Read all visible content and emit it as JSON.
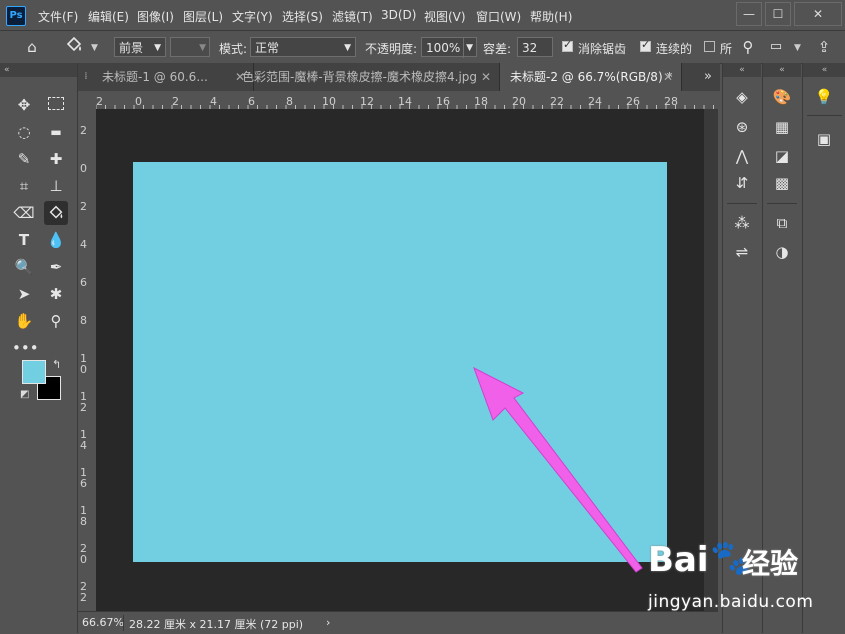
{
  "app": {
    "logo_text": "Ps"
  },
  "menu": [
    "文件(F)",
    "编辑(E)",
    "图像(I)",
    "图层(L)",
    "文字(Y)",
    "选择(S)",
    "滤镜(T)",
    "3D(D)",
    "视图(V)",
    "窗口(W)",
    "帮助(H)"
  ],
  "window_controls": {
    "minimize": "—",
    "maximize": "☐",
    "close": "✕"
  },
  "options": {
    "fill_source": "前景",
    "mode_label": "模式:",
    "mode_value": "正常",
    "opacity_label": "不透明度:",
    "opacity_value": "100%",
    "tolerance_label": "容差:",
    "tolerance_value": "32",
    "antialias_label": "消除锯齿",
    "contiguous_label": "连续的",
    "all_layers_label": "所"
  },
  "tabs": [
    {
      "label": "未标题-1 @ 60.6...",
      "active": false
    },
    {
      "label": "色彩范围-魔棒-背景橡皮擦-魔术橡皮擦4.jpg",
      "active": false
    },
    {
      "label": "未标题-2 @ 66.7%(RGB/8) *",
      "active": true
    }
  ],
  "tab_overflow": "»",
  "hruler_ticks": [
    "2",
    "0",
    "2",
    "4",
    "6",
    "8",
    "10",
    "12",
    "14",
    "16",
    "18",
    "20",
    "22",
    "24",
    "26",
    "28"
  ],
  "vruler_ticks": [
    "2",
    "0",
    "2",
    "4",
    "6",
    "8",
    "1\n0",
    "1\n2",
    "1\n4",
    "1\n6",
    "1\n8",
    "2\n0",
    "2\n2"
  ],
  "status": {
    "zoom": "66.67%",
    "doc_info": "28.22 厘米 x 21.17 厘米 (72 ppi)",
    "arrow": "›"
  },
  "colors": {
    "foreground": "#72cfe2",
    "background": "#000000",
    "canvas": "#72cfe2",
    "annotation_arrow": "#f060e8"
  },
  "watermark": {
    "logo": "Bai",
    "paw": "🐾",
    "jingyan": "经验",
    "url": "jingyan.baidu.com"
  }
}
